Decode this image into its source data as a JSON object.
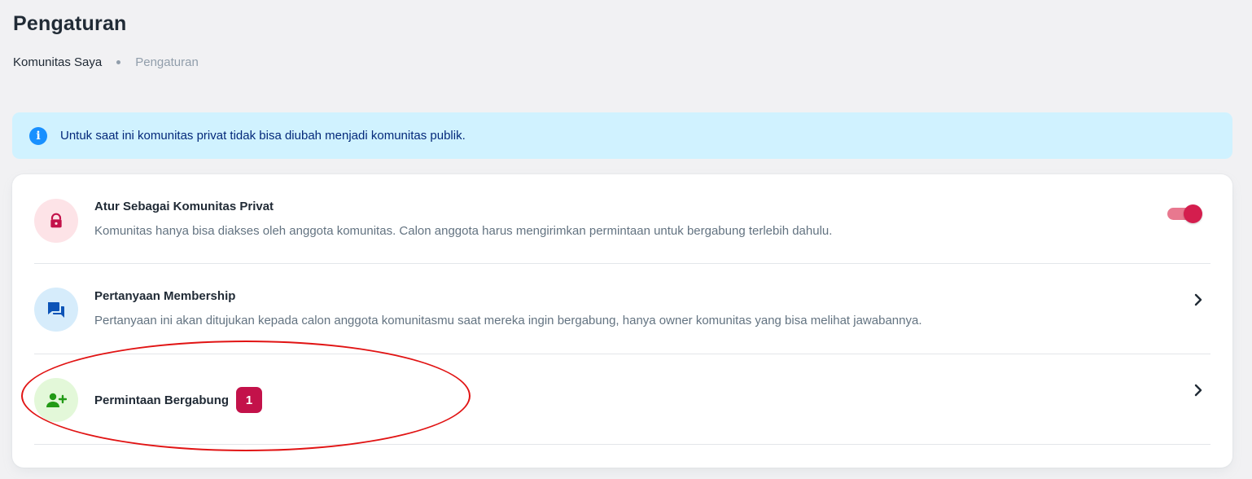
{
  "page": {
    "title": "Pengaturan"
  },
  "breadcrumb": {
    "items": [
      "Komunitas Saya",
      "Pengaturan"
    ]
  },
  "alert": {
    "icon": "info-icon",
    "text": "Untuk saat ini komunitas privat tidak bisa diubah menjadi komunitas publik.",
    "color": "#d0f2ff"
  },
  "settings": {
    "items": [
      {
        "icon": "lock-icon",
        "title": "Atur Sebagai Komunitas Privat",
        "description": "Komunitas hanya bisa diakses oleh anggota komunitas. Calon anggota harus mengirimkan permintaan untuk bergabung terlebih dahulu.",
        "control": "toggle",
        "toggle_on": true
      },
      {
        "icon": "chat-bubbles-icon",
        "title": "Pertanyaan Membership",
        "description": "Pertanyaan ini akan ditujukan kepada calon anggota komunitasmu saat mereka ingin bergabung, hanya owner komunitas yang bisa melihat jawabannya.",
        "control": "chevron-right-icon"
      },
      {
        "icon": "add-user-icon",
        "title": "Permintaan Bergabung",
        "badge": "1",
        "control": "chevron-right-icon"
      }
    ]
  },
  "colors": {
    "accent": "#d41e4e",
    "badge": "#c3124a",
    "annotation": "#e11414"
  }
}
